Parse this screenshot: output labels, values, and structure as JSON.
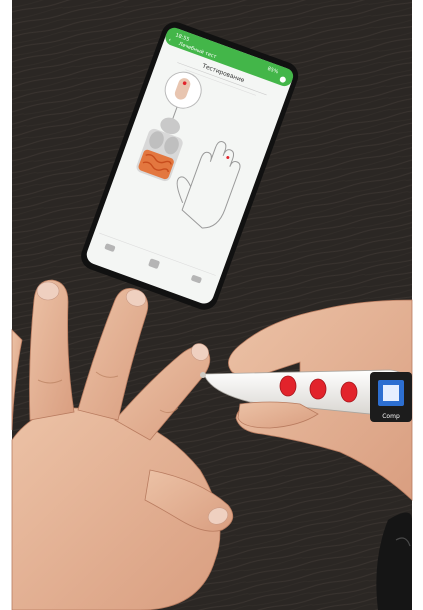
{
  "photo": {
    "subject": "Smartphone app guiding a finger measurement with a handheld pen device",
    "colors": {
      "table": "#2b2724",
      "table_grain": "#3a3430",
      "phone_body": "#111111",
      "screen_bg": "#f4f6f4",
      "app_bar": "#43b649",
      "skin": "#e7b79a",
      "skin_shadow": "#c98f72",
      "pen_body": "#f2f0ec",
      "pen_buttons": "#e2232b"
    }
  },
  "app_screen": {
    "title": "Тестирование",
    "status_time": "18:55",
    "battery": "85%",
    "app_bar_label": "Лечебный тест",
    "icon_names": [
      "back-arrow-icon",
      "settings-icon",
      "finger-icon",
      "body-organs-icon",
      "open-hand-icon",
      "bottom-nav-icons"
    ]
  },
  "device": {
    "brand": "Comp",
    "buttons": 3
  }
}
